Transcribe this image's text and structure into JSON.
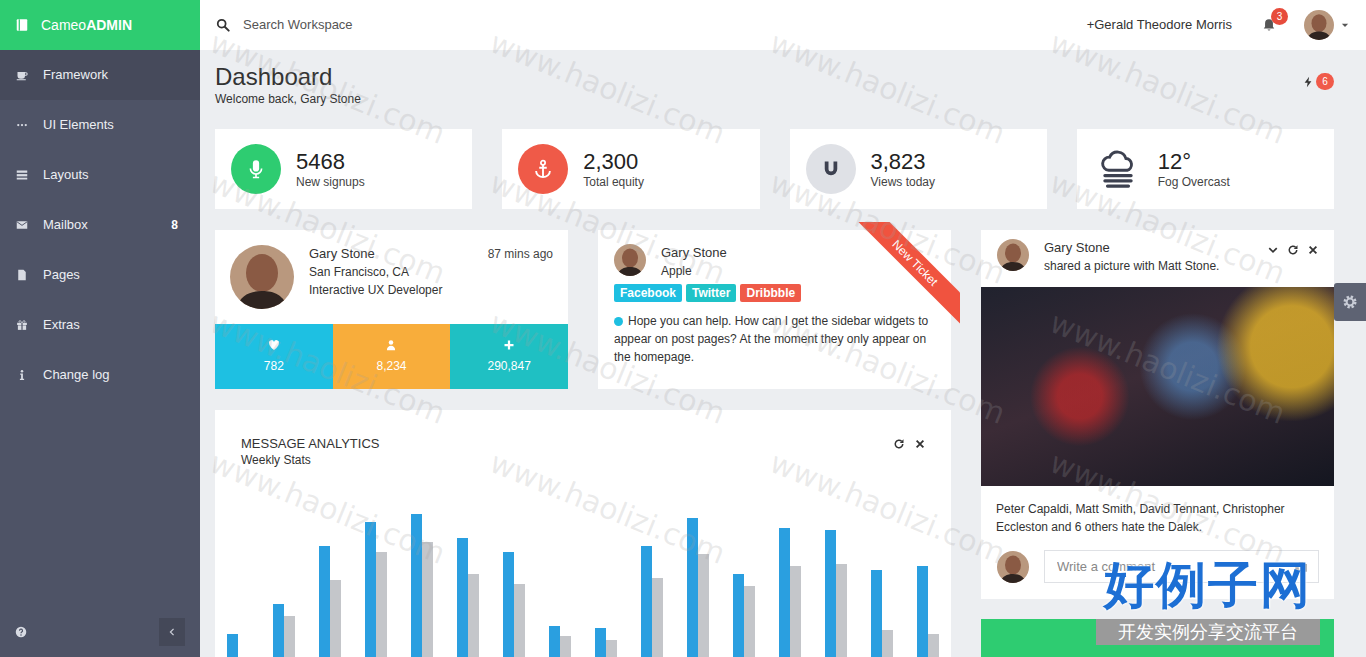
{
  "brand": {
    "name": "Cameo",
    "strong": "ADMIN"
  },
  "sidebar": {
    "items": [
      {
        "label": "Framework",
        "selected": true
      },
      {
        "label": "UI Elements",
        "selected": false
      },
      {
        "label": "Layouts",
        "selected": false
      },
      {
        "label": "Mailbox",
        "selected": false,
        "badge": "8"
      },
      {
        "label": "Pages",
        "selected": false
      },
      {
        "label": "Extras",
        "selected": false
      },
      {
        "label": "Change log",
        "selected": false
      }
    ]
  },
  "topbar": {
    "search": {
      "placeholder": "Search Workspace"
    },
    "user": "+Gerald Theodore Morris",
    "notifications": "3"
  },
  "header": {
    "title": "Dashboard",
    "subtitle": "Welcome back, Gary Stone",
    "alerts": "6"
  },
  "stats": [
    {
      "value": "5468",
      "label": "New signups",
      "color": "#2ecc71",
      "kind": "circle"
    },
    {
      "value": "2,300",
      "label": "Total equity",
      "color": "#ef5a48",
      "kind": "circle"
    },
    {
      "value": "3,823",
      "label": "Views today",
      "color": "#dfe1e6",
      "kind": "circle"
    },
    {
      "value": "12°",
      "label": "Fog Overcast",
      "color": "#3d4150",
      "kind": "plain"
    }
  ],
  "profile": {
    "name": "Gary Stone",
    "location": "San Francisco, CA",
    "role": "Interactive UX Developer",
    "time": "87 mins ago",
    "counters": [
      {
        "value": "782",
        "color": "#1ec0e2"
      },
      {
        "value": "8,234",
        "color": "#f8ad3b"
      },
      {
        "value": "290,847",
        "color": "#1fc0c3"
      }
    ]
  },
  "ticket": {
    "name": "Gary Stone",
    "company": "Apple",
    "ribbon": "New Ticket",
    "tags": [
      {
        "label": "Facebook",
        "color": "#1ebfe1"
      },
      {
        "label": "Twitter",
        "color": "#1fc3c7"
      },
      {
        "label": "Dribbble",
        "color": "#ef5a48"
      }
    ],
    "message": "Hope you can help. How can I get the sidebar widgets to appear on post pages? At the moment they only appear on the homepage."
  },
  "analytics": {
    "title": "MESSAGE ANALYTICS",
    "subtitle": "Weekly Stats",
    "series": [
      {
        "color": "#2a9fe0",
        "values": [
          22,
          37,
          66,
          78,
          82,
          70,
          63,
          26,
          25,
          66,
          80,
          52,
          75,
          74,
          54,
          56
        ]
      },
      {
        "color": "#c4c6ca",
        "values": [
          10,
          31,
          49,
          63,
          68,
          52,
          47,
          21,
          19,
          50,
          62,
          46,
          56,
          57,
          24,
          22
        ]
      }
    ]
  },
  "feed": {
    "name": "Gary Stone",
    "action": "shared a picture with Matt Stone.",
    "caption": "Peter Capaldi, Matt Smith, David Tennant, Christopher Eccleston and 6 others hate the Dalek.",
    "comment": {
      "placeholder": "Write a comment"
    }
  },
  "watermark": {
    "text": "www.haolizi.com",
    "logo": "好例子网",
    "tagline": "开发实例分享交流平台"
  }
}
